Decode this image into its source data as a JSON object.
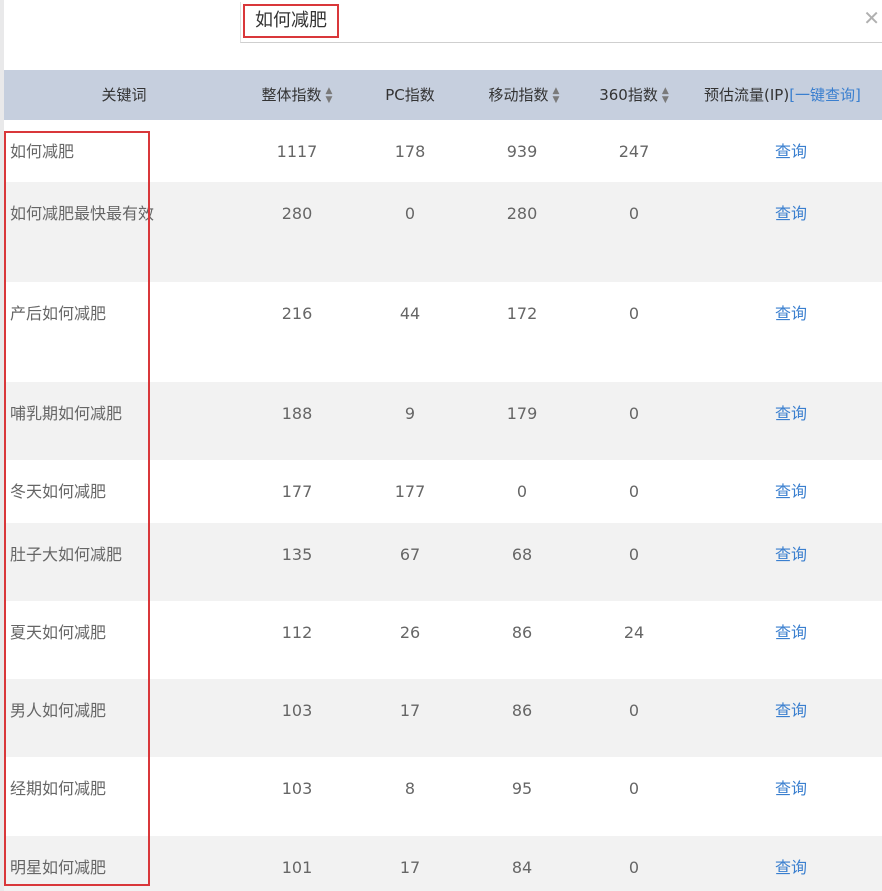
{
  "search": {
    "value": "如何减肥",
    "clear_icon": "close-icon"
  },
  "table": {
    "headers": {
      "keyword": "关键词",
      "total": "整体指数",
      "pc": "PC指数",
      "mobile": "移动指数",
      "i360": "360指数",
      "traffic": "预估流量(IP)",
      "query_all": "[一键查询]"
    },
    "sort_icon": "sort-icon",
    "rows": [
      {
        "keyword": "如何减肥",
        "total": "1117",
        "pc": "178",
        "mobile": "939",
        "i360": "247",
        "action": "查询"
      },
      {
        "keyword": "如何减肥最快最有效",
        "total": "280",
        "pc": "0",
        "mobile": "280",
        "i360": "0",
        "action": "查询"
      },
      {
        "keyword": "产后如何减肥",
        "total": "216",
        "pc": "44",
        "mobile": "172",
        "i360": "0",
        "action": "查询"
      },
      {
        "keyword": "哺乳期如何减肥",
        "total": "188",
        "pc": "9",
        "mobile": "179",
        "i360": "0",
        "action": "查询"
      },
      {
        "keyword": "冬天如何减肥",
        "total": "177",
        "pc": "177",
        "mobile": "0",
        "i360": "0",
        "action": "查询"
      },
      {
        "keyword": "肚子大如何减肥",
        "total": "135",
        "pc": "67",
        "mobile": "68",
        "i360": "0",
        "action": "查询"
      },
      {
        "keyword": "夏天如何减肥",
        "total": "112",
        "pc": "26",
        "mobile": "86",
        "i360": "24",
        "action": "查询"
      },
      {
        "keyword": "男人如何减肥",
        "total": "103",
        "pc": "17",
        "mobile": "86",
        "i360": "0",
        "action": "查询"
      },
      {
        "keyword": "经期如何减肥",
        "total": "103",
        "pc": "8",
        "mobile": "95",
        "i360": "0",
        "action": "查询"
      },
      {
        "keyword": "明星如何减肥",
        "total": "101",
        "pc": "17",
        "mobile": "84",
        "i360": "0",
        "action": "查询"
      }
    ]
  },
  "colors": {
    "header_bg": "#c6cfde",
    "link": "#3a7fcf",
    "highlight": "#d9373a",
    "alt_row": "#f2f2f2"
  }
}
